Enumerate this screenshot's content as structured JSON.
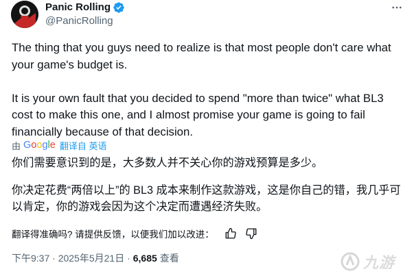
{
  "author": {
    "display_name": "Panic Rolling",
    "handle": "@PanicRolling",
    "verified": true
  },
  "tweet": {
    "paragraph_1": "The thing that you guys need to realize is that most people don't care what your game's budget is.",
    "paragraph_2": "It is your own fault that you decided to spend \"more than twice\" what BL3 cost to make this one, and I almost promise your game is going to fail financially because of that decision."
  },
  "translation": {
    "by_label": "由",
    "provider": "Google",
    "translated_label": "翻译自 英语",
    "paragraph_1": "你们需要意识到的是，大多数人并不关心你的游戏预算是多少。",
    "paragraph_2": "你决定花费“两倍以上”的 BL3 成本来制作这款游戏，这是你自己的错，我几乎可以肯定，你的游戏会因为这个决定而遭遇经济失败。"
  },
  "feedback": {
    "label": "翻译得准确吗? 请提供反馈，以便我们加以改进："
  },
  "meta": {
    "timestamp": "下午9:37 · 2025年5月21日 · ",
    "views_count": "6,685",
    "views_label": "查看"
  },
  "colors": {
    "text": "#0f1419",
    "secondary": "#536471",
    "accent": "#1d9bf0"
  },
  "icons": {
    "verified": "verified-badge-icon",
    "more": "more-options-icon",
    "thumbs_up": "thumbs-up-icon",
    "thumbs_down": "thumbs-down-icon"
  }
}
